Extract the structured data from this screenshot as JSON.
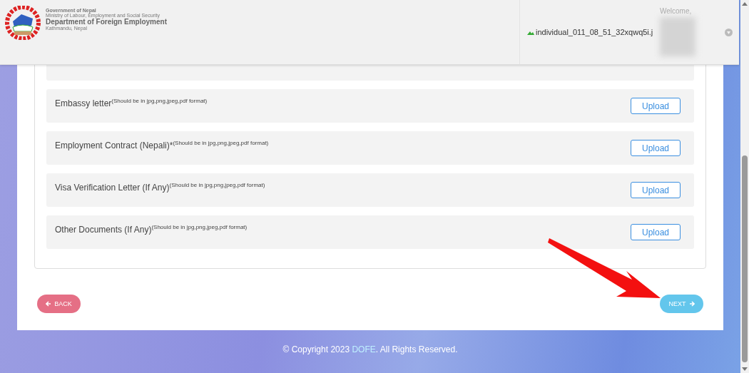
{
  "header": {
    "government": "Government of Nepal",
    "ministry": "Ministry of Labour, Employment and Social Security",
    "department": "Department of Foreign Employment",
    "location": "Kathmandu, Nepal"
  },
  "user": {
    "welcome": "Welcome,",
    "image_alt": "individual_011_08_51_32xqwq5i.j"
  },
  "documents": [
    {
      "label": "Embassy letter$^{(Should be in jpg,png,jpeg,pdf format)}$",
      "button": "Upload"
    },
    {
      "label": "Employment Contract (Nepali)*$^{(Should be in jpg,png,jpeg,pdf format)}$",
      "button": "Upload"
    },
    {
      "label": "Visa Verification Letter (If Any)$^{(Should be in jpg,png,jpeg,pdf format)}$",
      "button": "Upload"
    },
    {
      "label": "Other Documents (If Any)$^{(Should be in jpg,png,jpeg,pdf format)}$",
      "button": "Upload"
    }
  ],
  "nav": {
    "back": "BACK",
    "next": "NEXT"
  },
  "footer": {
    "prefix": "© Copyright 2023 ",
    "link": "DOFE",
    "suffix": ". All Rights Reserved."
  }
}
